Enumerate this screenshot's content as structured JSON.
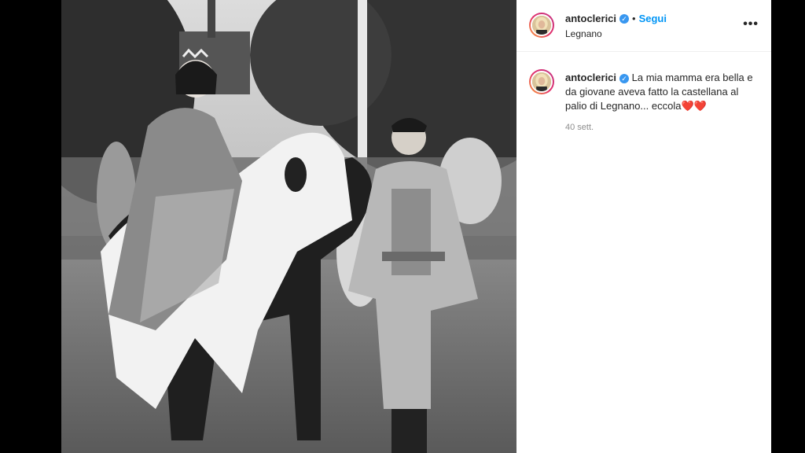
{
  "post": {
    "username": "antoclerici",
    "verified_icon": "verified-badge-icon",
    "separator": "•",
    "follow_label": "Segui",
    "location": "Legnano",
    "more_icon": "more-options-icon",
    "more_label": "•••"
  },
  "caption": {
    "username": "antoclerici",
    "text": "La mia mamma era bella e da giovane aveva fatto la castellana al palio di Legnano... eccola",
    "emoji": "❤️❤️",
    "time": "40 sett."
  },
  "colors": {
    "accent": "#0095f6",
    "verified": "#3897f0",
    "text": "#262626",
    "muted": "#8e8e8e"
  }
}
